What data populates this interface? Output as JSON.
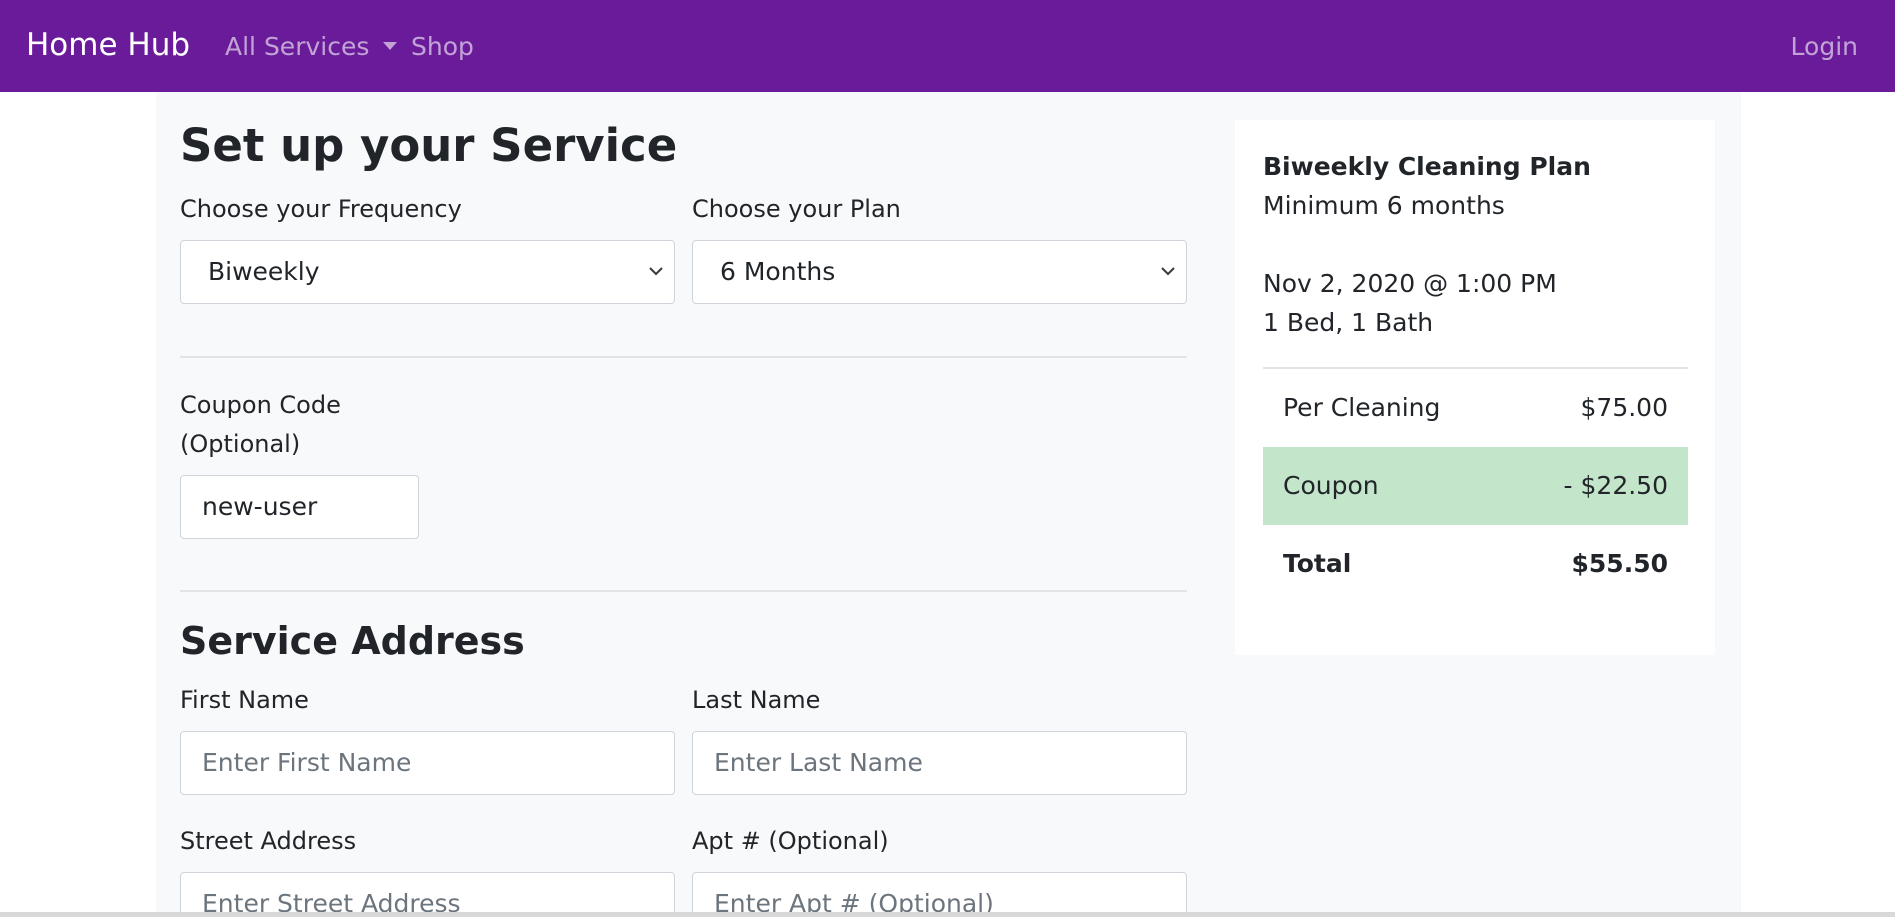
{
  "navbar": {
    "brand": "Home Hub",
    "services_label": "All Services",
    "shop_label": "Shop",
    "login_label": "Login",
    "background_color": "#6a1b9a"
  },
  "form": {
    "title": "Set up your Service",
    "frequency": {
      "label": "Choose your Frequency",
      "value": "Biweekly"
    },
    "plan": {
      "label": "Choose your Plan",
      "value": "6 Months"
    },
    "coupon": {
      "label_line1": "Coupon Code",
      "label_line2": "(Optional)",
      "value": "new-user"
    }
  },
  "address": {
    "title": "Service Address",
    "first_name": {
      "label": "First Name",
      "placeholder": "Enter First Name"
    },
    "last_name": {
      "label": "Last Name",
      "placeholder": "Enter Last Name"
    },
    "street": {
      "label": "Street Address",
      "placeholder": "Enter Street Address"
    },
    "apt": {
      "label": "Apt # (Optional)",
      "placeholder": "Enter Apt # (Optional)"
    }
  },
  "summary": {
    "plan_name": "Biweekly Cleaning Plan",
    "minimum": "Minimum 6 months",
    "datetime": "Nov 2, 2020 @ 1:00 PM",
    "home": "1 Bed, 1 Bath",
    "per_cleaning": {
      "label": "Per Cleaning",
      "amount": "$75.00"
    },
    "coupon": {
      "label": "Coupon",
      "amount": "- $22.50",
      "color": "#c3e6cb"
    },
    "total": {
      "label": "Total",
      "amount": "$55.50"
    }
  },
  "icons": {
    "dropdown_caret": "caret-down-icon",
    "select_chevron": "chevron-down-icon"
  }
}
